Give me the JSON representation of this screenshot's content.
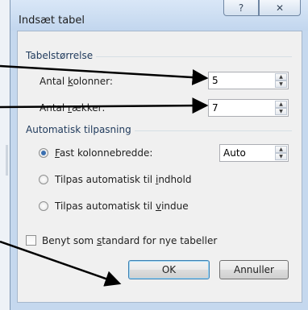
{
  "dialog": {
    "title": "Indsæt tabel",
    "help_glyph": "?",
    "close_glyph": "✕"
  },
  "table_size": {
    "heading": "Tabelstørrelse",
    "columns": {
      "label_pre": "Antal ",
      "label_key": "k",
      "label_post": "olonner:",
      "value": "5"
    },
    "rows": {
      "label_pre": "Antal ",
      "label_key": "r",
      "label_post": "ækker:",
      "value": "7"
    }
  },
  "autofit": {
    "heading": "Automatisk tilpasning",
    "fixed": {
      "label_pre": "",
      "label_key": "F",
      "label_post": "ast kolonnebredde:",
      "value": "Auto",
      "checked": true
    },
    "content": {
      "label_pre": "Tilpas automatisk til ",
      "label_key": "i",
      "label_post": "ndhold",
      "checked": false
    },
    "window": {
      "label_pre": "Tilpas automatisk til ",
      "label_key": "v",
      "label_post": "indue",
      "checked": false
    }
  },
  "default_checkbox": {
    "label_pre": "Benyt som ",
    "label_key": "s",
    "label_post": "tandard for nye tabeller",
    "checked": false
  },
  "buttons": {
    "ok": "OK",
    "cancel": "Annuller"
  }
}
